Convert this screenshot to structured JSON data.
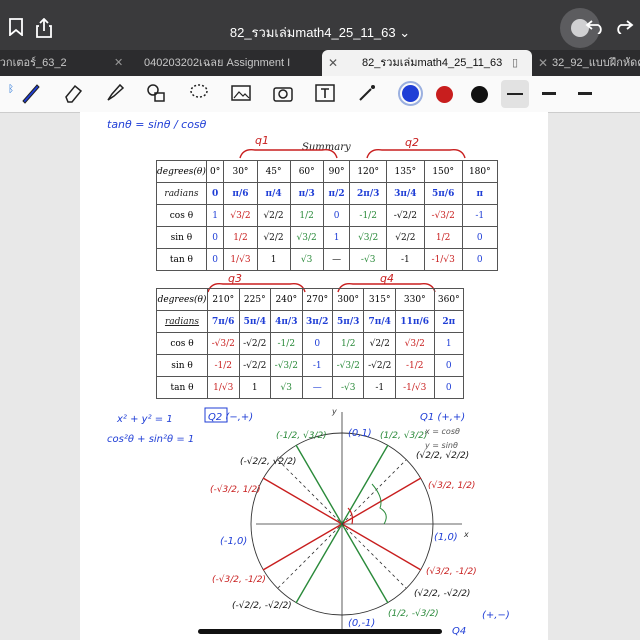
{
  "window": {
    "title": "82_รวมเล่มmath4_25_11_63 ⌄"
  },
  "tabs": [
    {
      "label": "เวกเตอร์_63_2",
      "active": false
    },
    {
      "label": "040203202เฉลย Assignment I",
      "active": false
    },
    {
      "label": "82_รวมเล่มmath4_25_11_63",
      "active": true
    },
    {
      "label": "32_92_แบบฝึกหัดคว",
      "active": false
    }
  ],
  "toolbar": {
    "colors": {
      "blue": "#1f3ed6",
      "red": "#c81e1e",
      "black": "#111111"
    }
  },
  "doc": {
    "tan_note": "tanθ = sinθ / cosθ",
    "summary_title": "Summary",
    "q_labels": [
      "q1",
      "q2",
      "q3",
      "q4"
    ],
    "table1": {
      "header": [
        "degrees(θ)",
        "0°",
        "30°",
        "45°",
        "60°",
        "90°",
        "120°",
        "135°",
        "150°",
        "180°"
      ],
      "rows": [
        [
          "radians",
          "0",
          "π/6",
          "π/4",
          "π/3",
          "π/2",
          "2π/3",
          "3π/4",
          "5π/6",
          "π"
        ],
        [
          "cos θ",
          "1",
          "√3/2",
          "√2/2",
          "1/2",
          "0",
          "-1/2",
          "-√2/2",
          "-√3/2",
          "-1"
        ],
        [
          "sin θ",
          "0",
          "1/2",
          "√2/2",
          "√3/2",
          "1",
          "√3/2",
          "√2/2",
          "1/2",
          "0"
        ],
        [
          "tan θ",
          "0",
          "1/√3",
          "1",
          "√3",
          "—",
          "-√3",
          "-1",
          "-1/√3",
          "0"
        ]
      ]
    },
    "table2": {
      "header": [
        "degrees(θ)",
        "210°",
        "225°",
        "240°",
        "270°",
        "300°",
        "315°",
        "330°",
        "360°"
      ],
      "rows": [
        [
          "radians",
          "7π/6",
          "5π/4",
          "4π/3",
          "3π/2",
          "5π/3",
          "7π/4",
          "11π/6",
          "2π"
        ],
        [
          "cos θ",
          "-√3/2",
          "-√2/2",
          "-1/2",
          "0",
          "1/2",
          "√2/2",
          "√3/2",
          "1"
        ],
        [
          "sin θ",
          "-1/2",
          "-√2/2",
          "-√3/2",
          "-1",
          "-√3/2",
          "-√2/2",
          "-1/2",
          "0"
        ],
        [
          "tan θ",
          "1/√3",
          "1",
          "√3",
          "—",
          "-√3",
          "-1",
          "-1/√3",
          "0"
        ]
      ]
    },
    "identity1": "x² + y² = 1",
    "identity2": "cos²θ + sin²θ = 1",
    "circle": {
      "q2_label": "Q2 (−,+)",
      "q1_label": "Q1 (+,+)",
      "q4_label": "Q4",
      "q4_sign": "(+,−)",
      "x_eq": "x = cosθ",
      "y_eq": "y = sinθ",
      "axis_x": "x",
      "axis_y": "y",
      "points": {
        "top": "(0,1)",
        "bottom": "(0,-1)",
        "left": "(-1,0)",
        "right": "(1,0)",
        "p1": "(1/2, √3/2)",
        "p2": "(√2/2, √2/2)",
        "p3": "(√3/2, 1/2)",
        "p4": "(-1/2, √3/2)",
        "p5": "(-√2/2, √2/2)",
        "p6": "(-√3/2, 1/2)",
        "p7": "(-√3/2, -1/2)",
        "p8": "(-√2/2, -√2/2)",
        "p9": "(1/2, -√3/2)",
        "p10": "(√3/2, -1/2)",
        "p11": "(√2/2, -√2/2)"
      }
    }
  }
}
